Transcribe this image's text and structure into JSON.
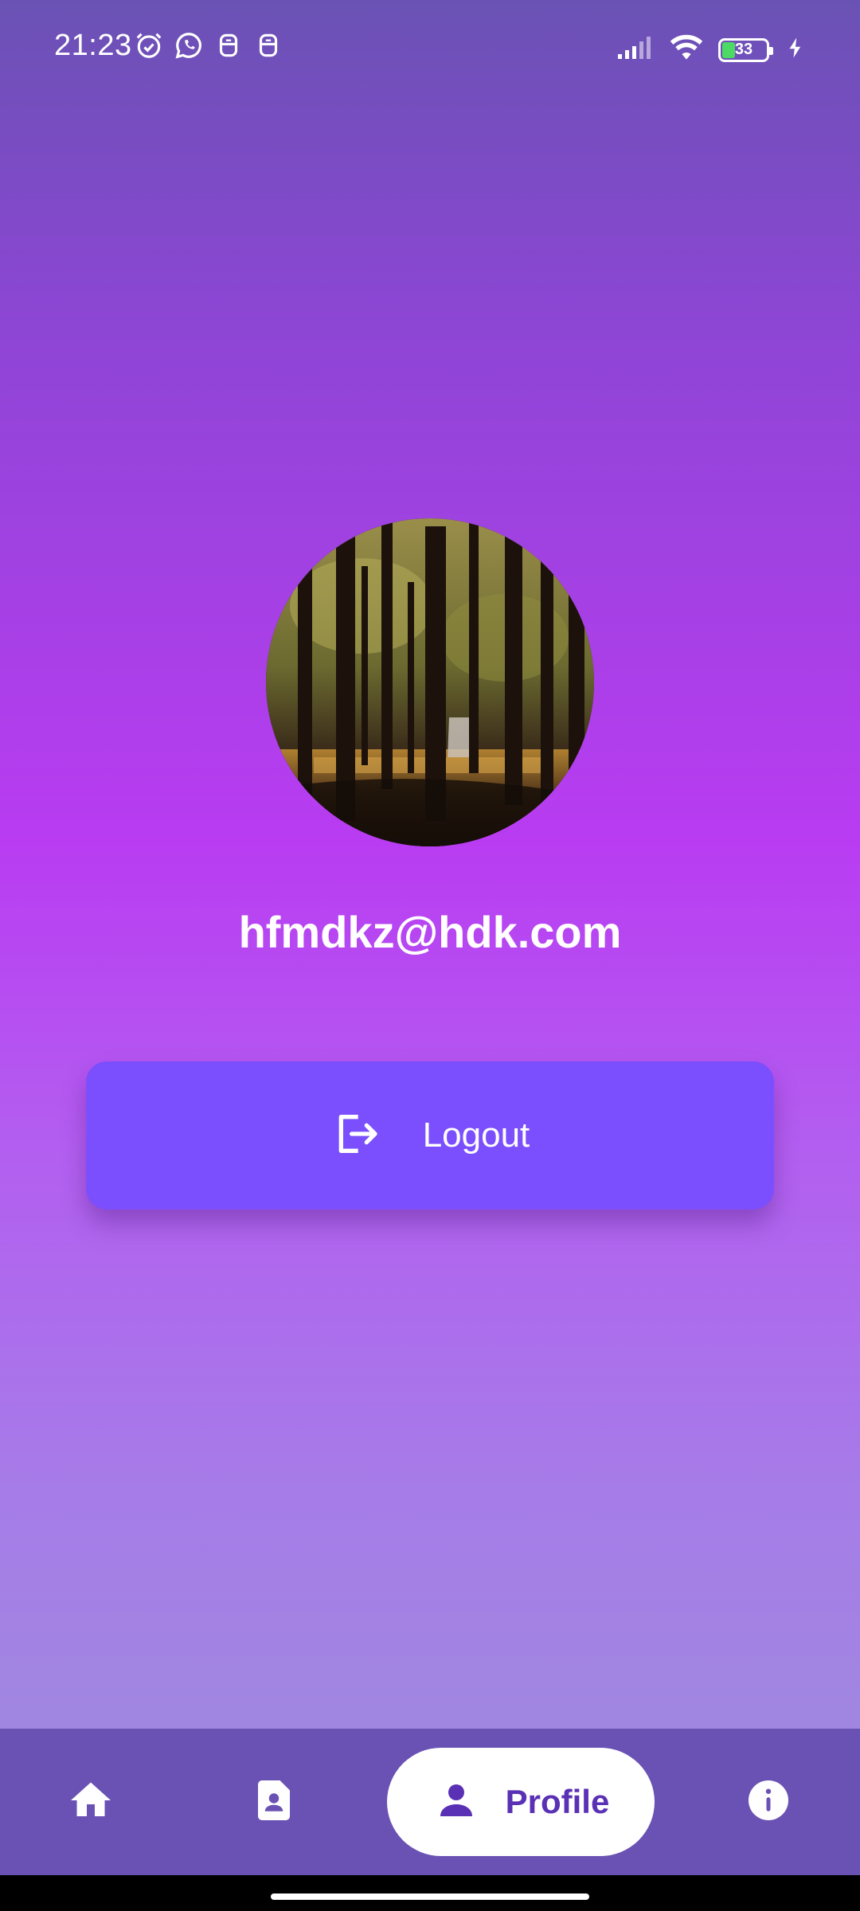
{
  "status_bar": {
    "time": "21:23",
    "battery_level": "33",
    "left_icons": [
      "alarm-icon",
      "whatsapp-icon",
      "notification-app-icon",
      "notification-app-icon"
    ],
    "right_icons": [
      "signal-icon",
      "wifi-icon",
      "battery-icon",
      "charging-icon"
    ]
  },
  "profile": {
    "avatar_icon": "forest-photo",
    "email": "hfmdkz@hdk.com"
  },
  "logout": {
    "label": "Logout",
    "icon": "logout-icon"
  },
  "bottom_nav": {
    "items": [
      {
        "id": "home",
        "icon": "home-icon",
        "label": ""
      },
      {
        "id": "contacts",
        "icon": "contact-card-icon",
        "label": ""
      },
      {
        "id": "profile",
        "icon": "person-icon",
        "label": "Profile",
        "selected": true
      },
      {
        "id": "info",
        "icon": "info-icon",
        "label": ""
      }
    ]
  },
  "colors": {
    "button": "#7b4ffd",
    "nav_background": "#6a52b4",
    "nav_selected_text": "#5a31b5",
    "battery_fill": "#4cd964"
  }
}
